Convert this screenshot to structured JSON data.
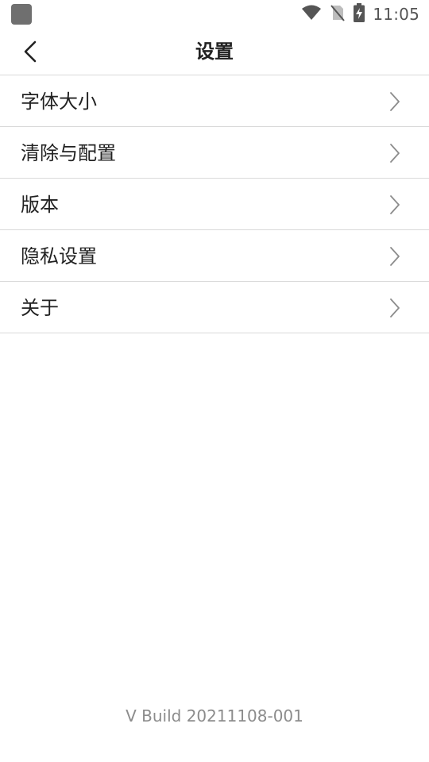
{
  "status_bar": {
    "time": "11:05",
    "icons": [
      "app-icon",
      "wifi-icon",
      "no-sim-icon",
      "battery-charging-icon"
    ]
  },
  "header": {
    "title": "设置",
    "back_icon": "chevron-left-icon"
  },
  "settings": {
    "items": [
      {
        "label": "字体大小"
      },
      {
        "label": "清除与配置"
      },
      {
        "label": "版本"
      },
      {
        "label": "隐私设置"
      },
      {
        "label": "关于"
      }
    ],
    "item_icon": "chevron-right-icon"
  },
  "footer": {
    "build": "V Build 20211108-001"
  },
  "colors": {
    "divider": "#d9d9d9",
    "text": "#222222",
    "muted": "#8c8c8c",
    "status": "#555555"
  }
}
